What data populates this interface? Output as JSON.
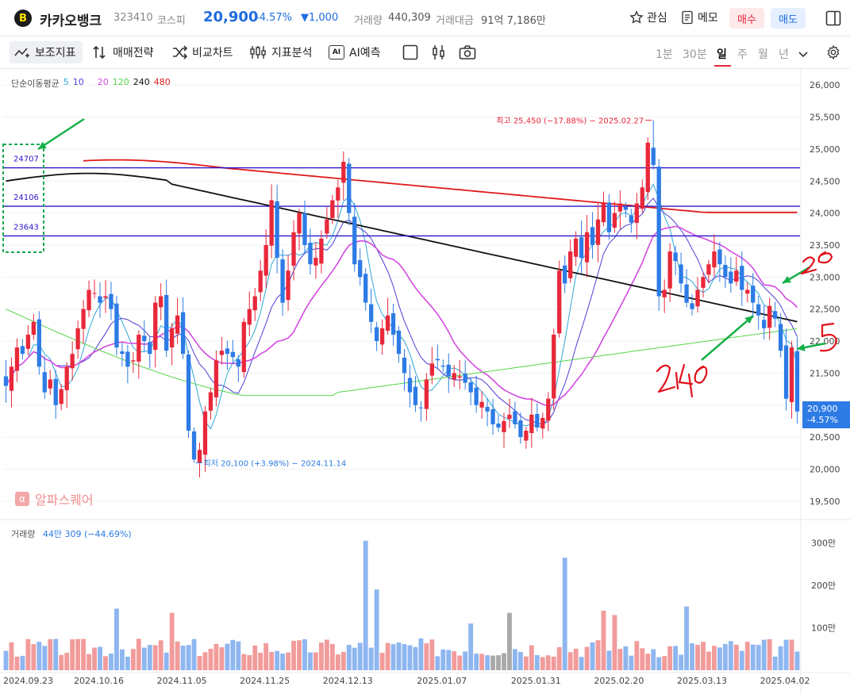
{
  "header": {
    "logo_letter": "B",
    "name": "카카오뱅크",
    "code": "323410",
    "market": "코스피",
    "price": "20,900",
    "change_pct": "-4.57%",
    "change_abs": "▼1,000",
    "volume_label": "거래량",
    "volume": "440,309",
    "amount_label": "거래대금",
    "amount": "91억 7,186만",
    "watch_label": "관심",
    "memo_label": "메모",
    "buy_label": "매수",
    "sell_label": "매도"
  },
  "toolbar": {
    "indicators": "보조지표",
    "strategy": "매매전략",
    "compare": "비교차트",
    "analysis": "지표분석",
    "ai_badge": "AI",
    "ai": "AI예측",
    "periods": [
      "1분",
      "30분",
      "일",
      "주",
      "월",
      "년"
    ],
    "selected_period": "일"
  },
  "legend": {
    "label": "단순이동평균",
    "items": [
      "5",
      "10",
      "20",
      "120",
      "240",
      "480"
    ],
    "colors": [
      "#2fa8d8",
      "#4a3fd6",
      "#d24ae0",
      "#57d44a",
      "#111111",
      "#e01b1b"
    ]
  },
  "watermark": "알파스퀘어",
  "volume_legend": {
    "label": "거래량",
    "value": "44만 309 (−44.69%)"
  },
  "annotations": {
    "high": "최고 25,450 (−17.88%) − 2025.02.27",
    "low": "최저 20,100 (+3.98%) − 2024.11.14",
    "box_levels": [
      "24707",
      "24106",
      "23643"
    ],
    "hand_20": "20",
    "hand_5": "5",
    "hand_240": "240"
  },
  "price_tag": {
    "price": "20,900",
    "pct": "-4.57%"
  },
  "colors": {
    "up": "#e8283a",
    "down": "#2d7be5",
    "accent": "#1e6ce0"
  },
  "chart_data": {
    "type": "candlestick",
    "ylim": [
      19250,
      26250
    ],
    "y_ticks": [
      26000,
      25500,
      25000,
      24500,
      24000,
      23500,
      23000,
      22500,
      22000,
      21500,
      21000,
      20500,
      20000,
      19500
    ],
    "y_tick_labels": [
      "26,000",
      "25,500",
      "25,000",
      "24,500",
      "24,000",
      "23,500",
      "23,000",
      "22,500",
      "22,000",
      "21,500",
      "21,000",
      "20,500",
      "20,000",
      "19,500"
    ],
    "x_tick_labels": [
      "2024.09.23",
      "2024.10.16",
      "2024.11.05",
      "2024.11.25",
      "2024.12.13",
      "2025.01.07",
      "2025.01.31",
      "2025.02.20",
      "2025.03.13",
      "2025.04.02"
    ],
    "x_tick_index": [
      0,
      17,
      32,
      47,
      62,
      79,
      96,
      111,
      126,
      141
    ],
    "horizontal_lines": [
      24707,
      24106,
      23643
    ],
    "closes": [
      21300,
      21600,
      21900,
      21800,
      22100,
      22300,
      21600,
      21200,
      21400,
      21000,
      21250,
      21600,
      21800,
      22200,
      22500,
      22800,
      22750,
      22600,
      22700,
      22500,
      21900,
      21800,
      21600,
      21700,
      22100,
      22000,
      21800,
      22600,
      22700,
      21850,
      22200,
      22400,
      21800,
      20600,
      20150,
      20300,
      20900,
      21200,
      21700,
      21850,
      21800,
      21750,
      21600,
      22300,
      22500,
      22700,
      23100,
      23500,
      24200,
      23300,
      22600,
      23100,
      23700,
      24000,
      23500,
      23200,
      23300,
      23600,
      23900,
      24200,
      24400,
      24800,
      24000,
      23200,
      23000,
      22600,
      22300,
      22000,
      22200,
      22400,
      22100,
      21800,
      21500,
      21200,
      21000,
      20950,
      21400,
      21650,
      21700,
      21600,
      21450,
      21500,
      21450,
      21350,
      21200,
      21000,
      21050,
      20900,
      20700,
      20650,
      20750,
      20850,
      20700,
      20500,
      20600,
      20850,
      20650,
      20800,
      21100,
      22100,
      23100,
      22900,
      23400,
      23600,
      23300,
      23700,
      23500,
      23900,
      24150,
      23700,
      24000,
      24150,
      24050,
      23850,
      24150,
      24400,
      25100,
      24750,
      22700,
      22800,
      23400,
      23250,
      22900,
      22600,
      22500,
      22800,
      23000,
      23200,
      23400,
      23200,
      23000,
      22900,
      23100,
      22800,
      22800,
      22600,
      22400,
      22200,
      22550,
      22350,
      21850,
      21100,
      21900,
      20900
    ]
  },
  "volume_data": {
    "ylim": [
      0,
      3400000
    ],
    "y_ticks": [
      1000000,
      2000000,
      3000000
    ],
    "y_tick_labels": [
      "100만",
      "200만",
      "300만"
    ]
  }
}
